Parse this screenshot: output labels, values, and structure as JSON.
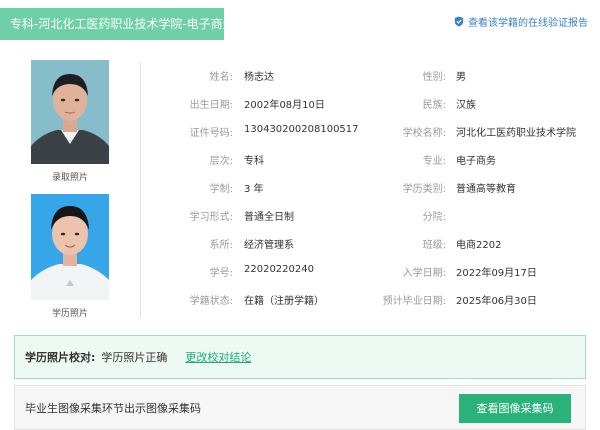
{
  "header": {
    "title": "专科-河北化工医药职业技术学院-电子商务",
    "verify_link": "查看该学籍的在线验证报告"
  },
  "photos": {
    "admission_caption": "录取照片",
    "education_caption": "学历照片"
  },
  "fields": {
    "name": {
      "label": "姓名:",
      "value": "杨志达"
    },
    "gender": {
      "label": "性别:",
      "value": "男"
    },
    "birthdate": {
      "label": "出生日期:",
      "value": "2002年08月10日"
    },
    "ethnicity": {
      "label": "民族:",
      "value": "汉族"
    },
    "id_number": {
      "label": "证件号码:",
      "value": "130430200208100517"
    },
    "school": {
      "label": "学校名称:",
      "value": "河北化工医药职业技术学院"
    },
    "level": {
      "label": "层次:",
      "value": "专科"
    },
    "major": {
      "label": "专业:",
      "value": "电子商务"
    },
    "duration": {
      "label": "学制:",
      "value": "3 年"
    },
    "category": {
      "label": "学历类别:",
      "value": "普通高等教育"
    },
    "study_form": {
      "label": "学习形式:",
      "value": "普通全日制"
    },
    "branch": {
      "label": "分院:",
      "value": ""
    },
    "department": {
      "label": "系所:",
      "value": "经济管理系"
    },
    "class": {
      "label": "班级:",
      "value": "电商2202"
    },
    "student_id": {
      "label": "学号:",
      "value": "22020220240"
    },
    "enroll_date": {
      "label": "入学日期:",
      "value": "2022年09月17日"
    },
    "status": {
      "label": "学籍状态:",
      "value": "在籍（注册学籍）"
    },
    "grad_date": {
      "label": "预计毕业日期:",
      "value": "2025年06月30日"
    }
  },
  "photo_check": {
    "label": "学历照片校对:",
    "value": "学历照片正确",
    "link": "更改校对结论"
  },
  "image_capture": {
    "text": "毕业生图像采集环节出示图像采集码",
    "button": "查看图像采集码"
  },
  "colors": {
    "accent": "#6fcfa8",
    "button": "#2bb17a",
    "link": "#3b82c4"
  }
}
